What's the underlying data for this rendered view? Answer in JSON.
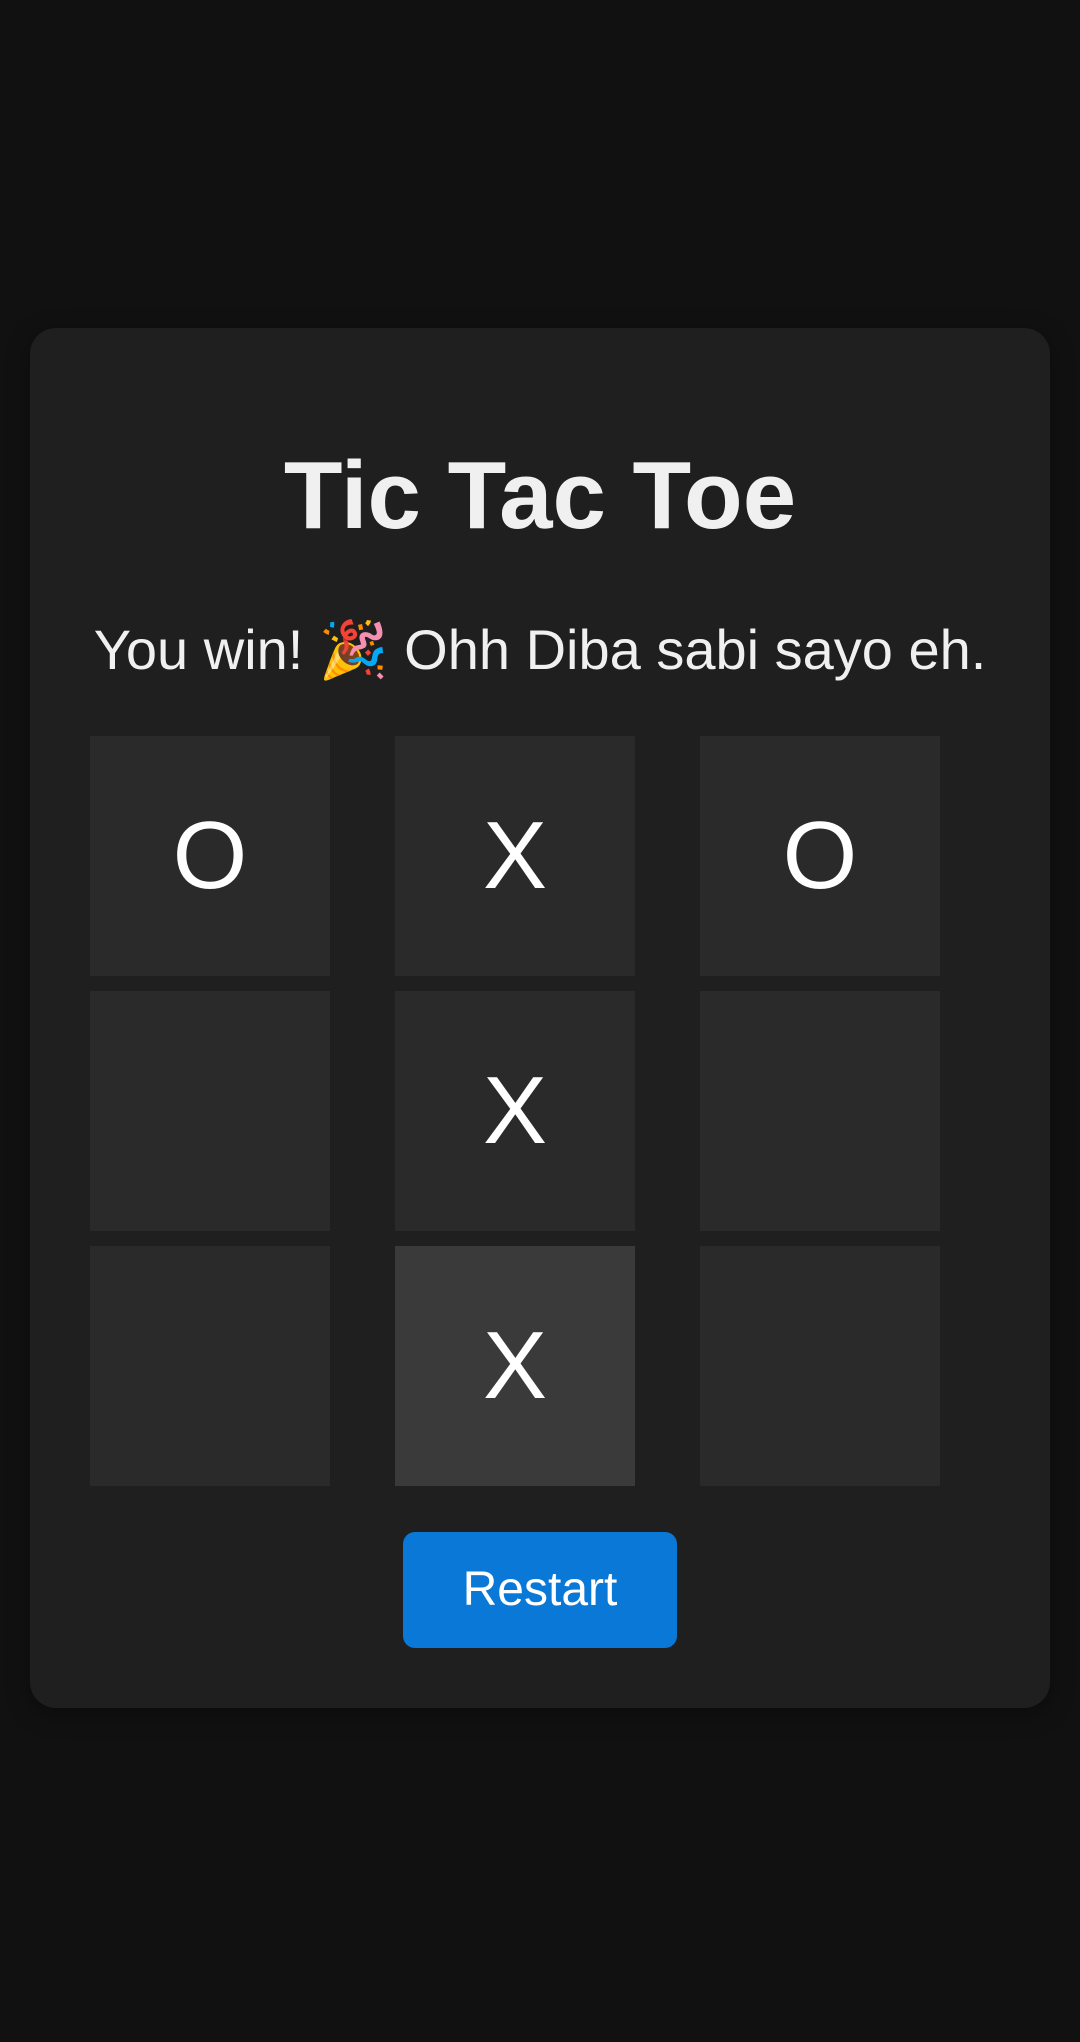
{
  "game": {
    "title": "Tic Tac Toe",
    "status": "You win! 🎉 Ohh Diba sabi sayo eh.",
    "board": [
      [
        "O",
        "X",
        "O"
      ],
      [
        "",
        "X",
        ""
      ],
      [
        "",
        "X",
        ""
      ]
    ],
    "restart_label": "Restart"
  },
  "colors": {
    "background": "#111111",
    "card": "#1f1f1f",
    "cell": "#2a2a2a",
    "cell_highlight": "#3a3a3a",
    "text": "#f0f0f0",
    "button": "#0a78d7"
  }
}
